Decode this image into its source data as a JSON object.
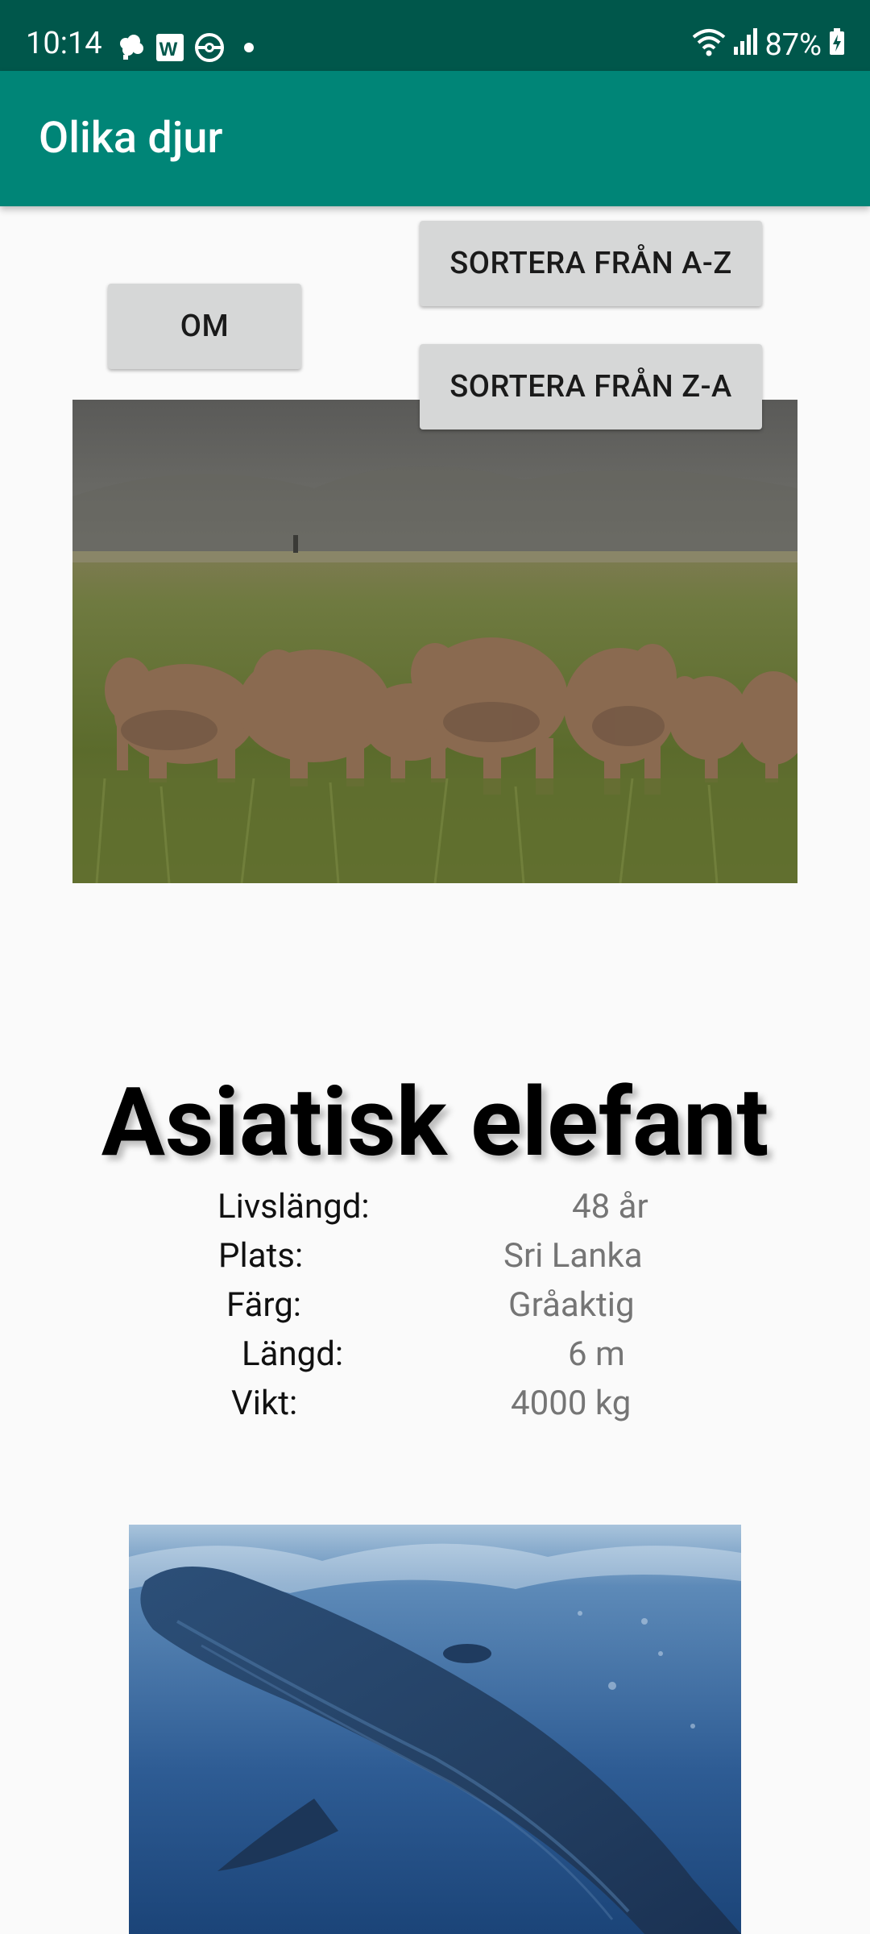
{
  "status_bar": {
    "time": "10:14",
    "battery": "87%",
    "left_icons": [
      "weather-icon",
      "word-app-icon",
      "pokeball-icon",
      "notification-dot-icon"
    ],
    "right_icons": [
      "wifi-icon",
      "signal-icon",
      "battery-icon"
    ]
  },
  "app_bar": {
    "title": "Olika djur",
    "color": "#008577",
    "status_color": "#00574b"
  },
  "buttons": {
    "sort_az": "SORTERA FRÅN A-Z",
    "about": "OM",
    "sort_za": "SORTERA FRÅN Z-A"
  },
  "animals": [
    {
      "image": "elephant-herd-photo",
      "name": "Asiatisk elefant",
      "fields": [
        {
          "label": "Livslängd:",
          "value": "48 år"
        },
        {
          "label": "Plats:",
          "value": "Sri Lanka"
        },
        {
          "label": "Färg:",
          "value": "Gråaktig"
        },
        {
          "label": "Längd:",
          "value": "6 m"
        },
        {
          "label": "Vikt:",
          "value": "4000 kg"
        }
      ]
    },
    {
      "image": "blue-whale-photo"
    }
  ]
}
